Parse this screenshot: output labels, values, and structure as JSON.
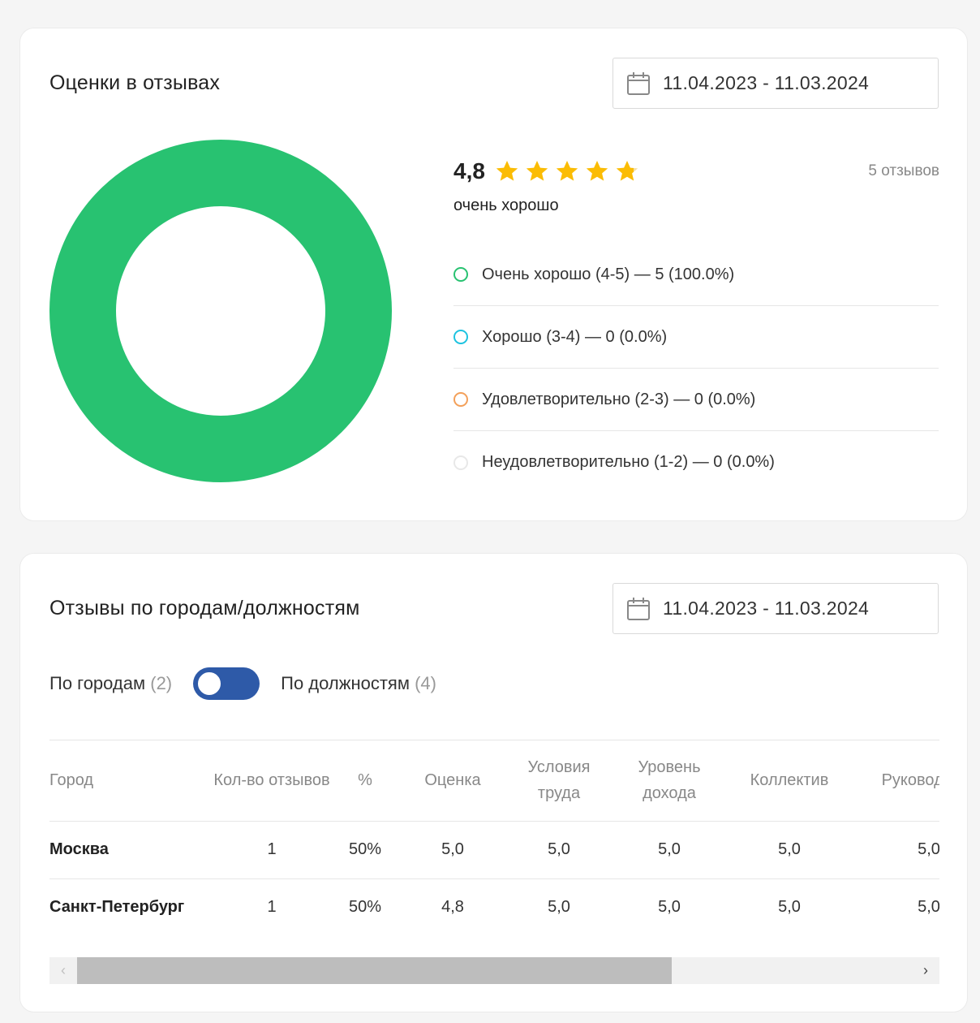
{
  "ratings_card": {
    "title": "Оценки в отзывах",
    "date_range": "11.04.2023 - 11.03.2024",
    "rating_value": "4,8",
    "rating_stars": 4.8,
    "rating_desc": "очень хорошо",
    "reviews_count": "5 отзывов",
    "legend": [
      {
        "label": "Очень хорошо (4-5) — 5 (100.0%)",
        "color": "#28c271"
      },
      {
        "label": "Хорошо (3-4) — 0 (0.0%)",
        "color": "#1ec3e0"
      },
      {
        "label": "Удовлетворительно (2-3) — 0 (0.0%)",
        "color": "#f3a05a"
      },
      {
        "label": "Неудовлетворительно (1-2) — 0 (0.0%)",
        "color": "#e8e8e8"
      }
    ],
    "donut": {
      "values": [
        100,
        0,
        0,
        0
      ],
      "colors": [
        "#28c271",
        "#1ec3e0",
        "#f3a05a",
        "#e8e8e8"
      ]
    }
  },
  "cities_card": {
    "title": "Отзывы по городам/должностям",
    "date_range": "11.04.2023 - 11.03.2024",
    "toggle": {
      "left_label": "По городам",
      "left_count": "(2)",
      "right_label": "По должностям",
      "right_count": "(4)"
    },
    "table": {
      "headers": [
        "Город",
        "Кол-во отзывов",
        "%",
        "Оценка",
        "Условия труда",
        "Уровень дохода",
        "Коллектив",
        "Руководство"
      ],
      "rows": [
        [
          "Москва",
          "1",
          "50%",
          "5,0",
          "5,0",
          "5,0",
          "5,0",
          "5,0"
        ],
        [
          "Санкт-Петербург",
          "1",
          "50%",
          "4,8",
          "5,0",
          "5,0",
          "5,0",
          "5,0"
        ]
      ]
    },
    "scrollbar": {
      "left_arrow": "‹",
      "right_arrow": "›"
    }
  },
  "colors": {
    "star": "#fbbc04",
    "accent_blue": "#2e5aa8"
  }
}
